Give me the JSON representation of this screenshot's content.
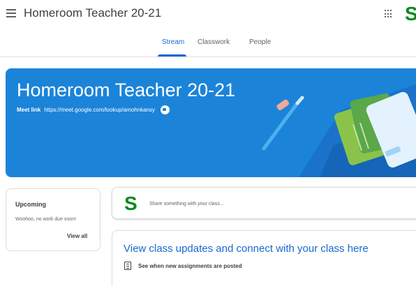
{
  "header": {
    "menu_icon": "hamburger-menu-icon",
    "title": "Homeroom Teacher 20-21",
    "apps_icon": "apps-grid-icon",
    "avatar_letter": "S",
    "avatar_color": "#0a8a1c"
  },
  "tabs": [
    {
      "label": "Stream",
      "active": true
    },
    {
      "label": "Classwork",
      "active": false
    },
    {
      "label": "People",
      "active": false
    }
  ],
  "banner": {
    "title": "Homeroom Teacher 20-21",
    "meet_label": "Meet link",
    "meet_url": "https://meet.google.com/lookup/amohnkansy",
    "meet_icon": "video-camera-icon",
    "background_color": "#1b84d9"
  },
  "upcoming": {
    "title": "Upcoming",
    "text": "Woohoo, no work due soon!",
    "view_all": "View all"
  },
  "share": {
    "avatar_letter": "S",
    "placeholder": "Share something with your class..."
  },
  "updates": {
    "title": "View class updates and connect with your class here",
    "item_icon": "assignment-icon",
    "item_text": "See when new assignments are posted"
  },
  "colors": {
    "accent": "#1967d2",
    "text": "#3c4043",
    "muted": "#5f6368",
    "border": "#dadce0"
  }
}
